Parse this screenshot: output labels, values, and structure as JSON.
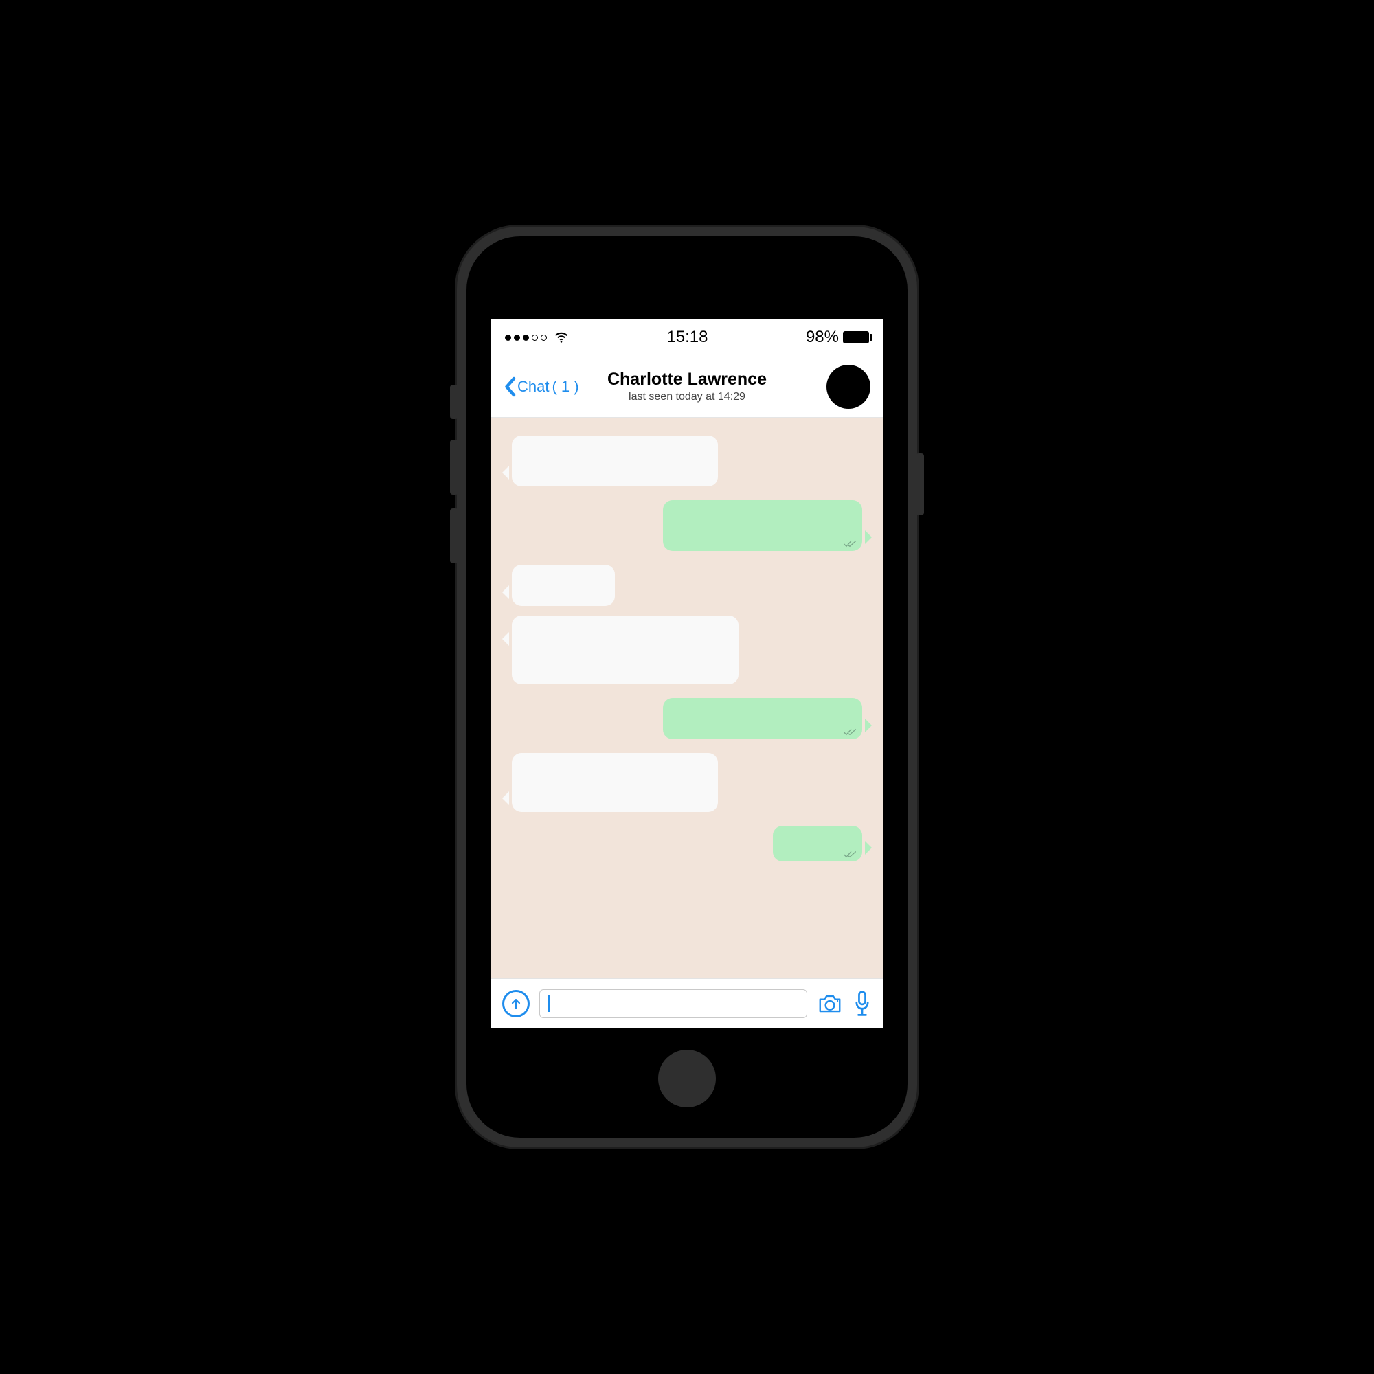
{
  "status": {
    "time": "15:18",
    "battery_text": "98%"
  },
  "header": {
    "back_label": "Chat",
    "unread_count": "( 1 )",
    "contact_name": "Charlotte Lawrence",
    "last_seen": "last seen today at 14:29"
  },
  "input": {
    "placeholder": ""
  }
}
